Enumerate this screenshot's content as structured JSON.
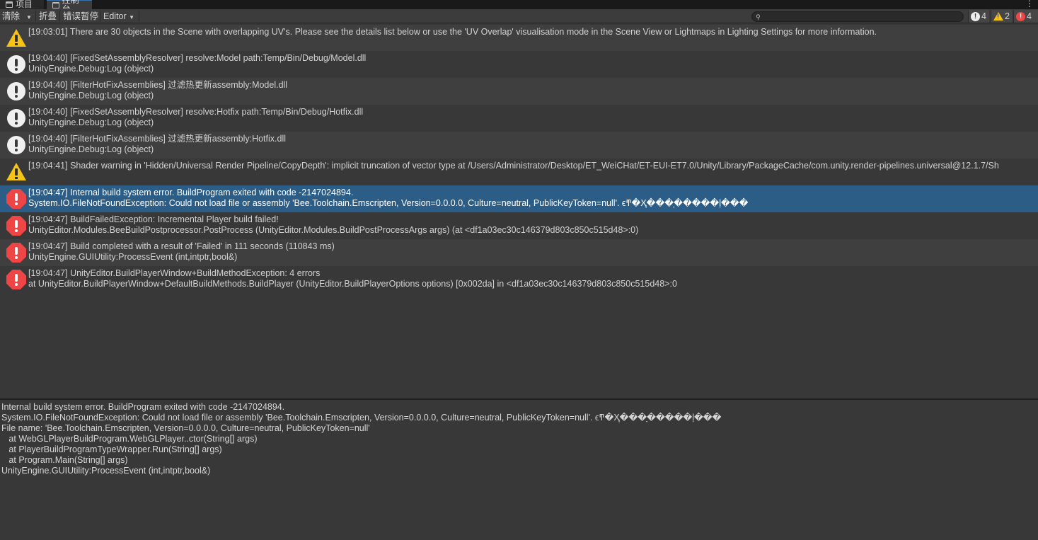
{
  "tabs": [
    {
      "label": "项目",
      "icon": "folder-icon"
    },
    {
      "label": "控制台",
      "icon": "console-icon",
      "active": true
    }
  ],
  "toolbar": {
    "clear_label": "清除",
    "collapse_label": "折叠",
    "error_pause_label": "错误暂停",
    "editor_label": "Editor",
    "search_placeholder": "",
    "counts": {
      "info": "4",
      "warning": "2",
      "error": "4"
    }
  },
  "logs": [
    {
      "type": "warning",
      "lines": [
        "[19:03:01] There are 30 objects in the Scene with overlapping UV's. Please see the details list below or use the 'UV Overlap' visualisation mode in the Scene View or Lightmaps in Lighting Settings for more information."
      ]
    },
    {
      "type": "info",
      "lines": [
        "[19:04:40] [FixedSetAssemblyResolver] resolve:Model path:Temp/Bin/Debug/Model.dll",
        "UnityEngine.Debug:Log (object)"
      ]
    },
    {
      "type": "info",
      "lines": [
        "[19:04:40] [FilterHotFixAssemblies] 过滤热更新assembly:Model.dll",
        "UnityEngine.Debug:Log (object)"
      ]
    },
    {
      "type": "info",
      "lines": [
        "[19:04:40] [FixedSetAssemblyResolver] resolve:Hotfix path:Temp/Bin/Debug/Hotfix.dll",
        "UnityEngine.Debug:Log (object)"
      ]
    },
    {
      "type": "info",
      "lines": [
        "[19:04:40] [FilterHotFixAssemblies] 过滤热更新assembly:Hotfix.dll",
        "UnityEngine.Debug:Log (object)"
      ]
    },
    {
      "type": "warning",
      "lines": [
        "[19:04:41] Shader warning in 'Hidden/Universal Render Pipeline/CopyDepth': implicit truncation of vector type at /Users/Administrator/Desktop/ET_WeiCHat/ET-EUI-ET7.0/Unity/Library/PackageCache/com.unity.render-pipelines.universal@12.1.7/Sh"
      ]
    },
    {
      "type": "error",
      "selected": true,
      "lines": [
        "[19:04:47] Internal build system error. BuildProgram exited with code -2147024894.",
        "System.IO.FileNotFoundException: Could not load file or assembly 'Bee.Toolchain.Emscripten, Version=0.0.0.0, Culture=neutral, PublicKeyToken=null'. ϵͳ�Ҳ���ָ�����ļ���"
      ]
    },
    {
      "type": "error",
      "lines": [
        "[19:04:47] BuildFailedException: Incremental Player build failed!",
        "UnityEditor.Modules.BeeBuildPostprocessor.PostProcess (UnityEditor.Modules.BuildPostProcessArgs args) (at <df1a03ec30c146379d803c850c515d48>:0)"
      ]
    },
    {
      "type": "error",
      "lines": [
        "[19:04:47] Build completed with a result of 'Failed' in 111 seconds (110843 ms)",
        "UnityEngine.GUIUtility:ProcessEvent (int,intptr,bool&)"
      ]
    },
    {
      "type": "error",
      "lines": [
        "[19:04:47] UnityEditor.BuildPlayerWindow+BuildMethodException: 4 errors",
        "  at UnityEditor.BuildPlayerWindow+DefaultBuildMethods.BuildPlayer (UnityEditor.BuildPlayerOptions options) [0x002da] in <df1a03ec30c146379d803c850c515d48>:0"
      ]
    }
  ],
  "detail": [
    "Internal build system error. BuildProgram exited with code -2147024894.",
    "System.IO.FileNotFoundException: Could not load file or assembly 'Bee.Toolchain.Emscripten, Version=0.0.0.0, Culture=neutral, PublicKeyToken=null'. ϵͳ�Ҳ���ָ�����ļ���",
    "File name: 'Bee.Toolchain.Emscripten, Version=0.0.0.0, Culture=neutral, PublicKeyToken=null'",
    "   at WebGLPlayerBuildProgram.WebGLPlayer..ctor(String[] args)",
    "   at PlayerBuildProgramTypeWrapper.Run(String[] args)",
    "   at Program.Main(String[] args)",
    "UnityEngine.GUIUtility:ProcessEvent (int,intptr,bool&)"
  ],
  "colors": {
    "accent": "#2c5d87",
    "error": "#ee4646",
    "warning": "#f6c317",
    "info": "#f0f0f0"
  }
}
